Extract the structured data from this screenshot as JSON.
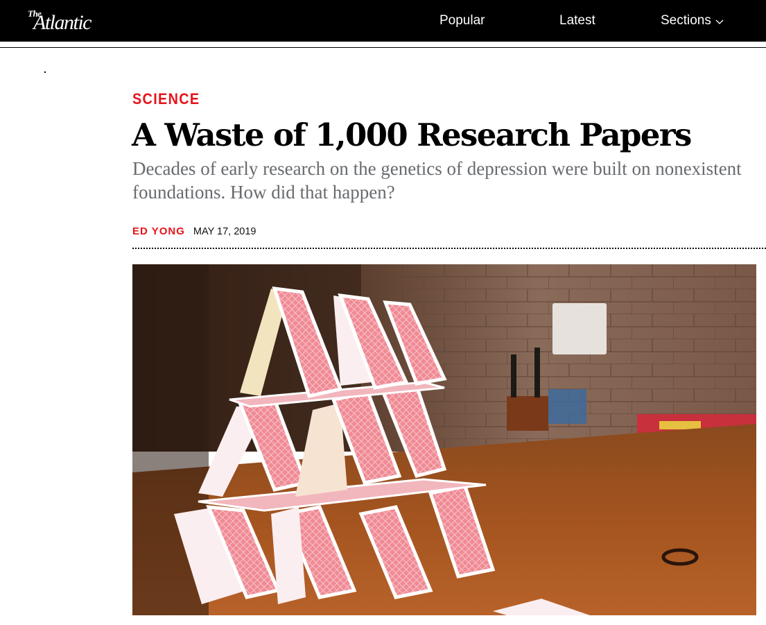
{
  "header": {
    "logo": {
      "the": "The",
      "name": "Atlantic"
    },
    "nav": {
      "popular": "Popular",
      "latest": "Latest",
      "sections": "Sections"
    }
  },
  "article": {
    "section": "SCIENCE",
    "headline": "A Waste of 1,000 Research Papers",
    "dek": "Decades of early research on the genetics of depression were built on nonexistent foundations. How did that happen?",
    "author": "ED YONG",
    "date": "MAY 17, 2019"
  },
  "hero_image": {
    "subject": "house-of-cards"
  },
  "colors": {
    "accent": "#e7131a",
    "topbar": "#000000",
    "dek": "#676a6e",
    "card_back": "#f08a94",
    "table": "#a4541f",
    "brick_wall": "#7b5a4a"
  }
}
